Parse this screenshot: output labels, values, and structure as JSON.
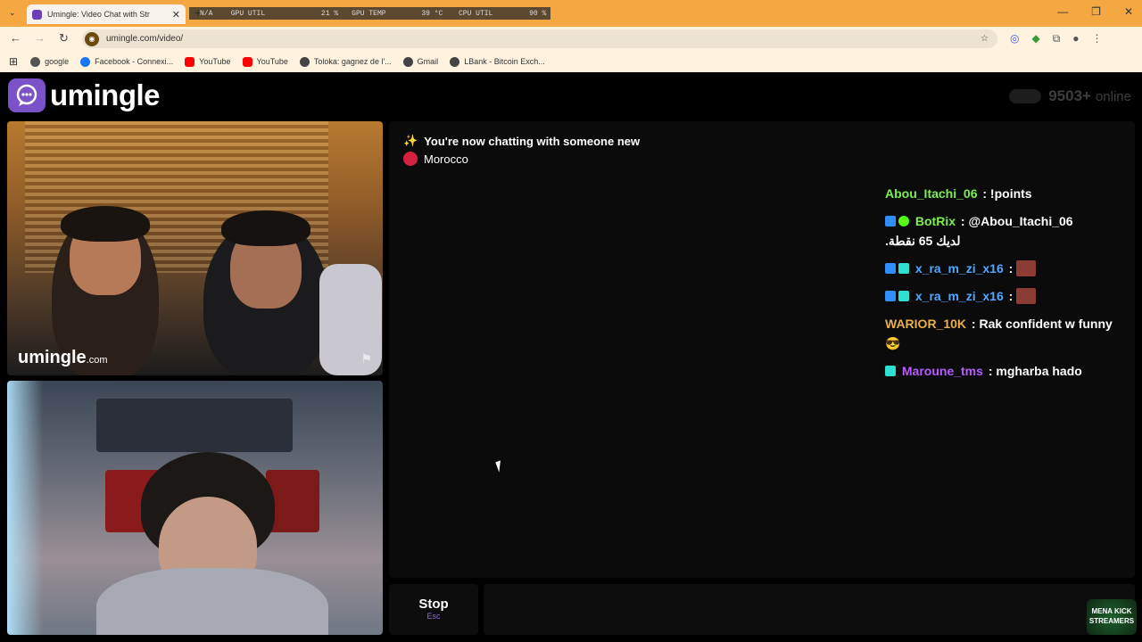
{
  "browser": {
    "tab_title": "Umingle: Video Chat with Str",
    "overlay": {
      "gpu_util_label": "GPU UTIL",
      "gpu_util_value": "21 %",
      "gpu_temp_label": "GPU TEMP",
      "gpu_temp_value": "39 °C",
      "cpu_util_label": "CPU UTIL",
      "cpu_util_value": "90 %",
      "na_label": "N/A"
    },
    "url": "umingle.com/video/",
    "bookmarks": [
      {
        "label": "google",
        "color": "#555555"
      },
      {
        "label": "Facebook - Connexi...",
        "color": "#1877f2"
      },
      {
        "label": "YouTube",
        "color": "#ff0000"
      },
      {
        "label": "YouTube",
        "color": "#ff0000"
      },
      {
        "label": "Toloka: gagnez de l'...",
        "color": "#444444"
      },
      {
        "label": "Gmail",
        "color": "#444444"
      },
      {
        "label": "LBank - Bitcoin Exch...",
        "color": "#444444"
      }
    ]
  },
  "site": {
    "logo_text": "umingle",
    "online_count": "9503+",
    "online_label": "online",
    "watermark_main": "umingle",
    "watermark_suffix": ".com"
  },
  "chat": {
    "system_message": "You're now chatting with someone new",
    "country": "Morocco",
    "messages": [
      {
        "name": "Abou_Itachi_06",
        "name_color": "#7cf04f",
        "text": ": !points"
      },
      {
        "name": "BotRix",
        "name_color": "#7cf04f",
        "text": ": @Abou_Itachi_06",
        "text_color": "#6fa8ff",
        "line2": "لديك 65 نقطة."
      },
      {
        "name": "x_ra_m_zi_x16",
        "name_color": "#52a8ff",
        "text": ":"
      },
      {
        "name": "x_ra_m_zi_x16",
        "name_color": "#52a8ff",
        "text": ":"
      },
      {
        "name": "WARIOR_10K",
        "name_color": "#e8b04a",
        "text": ": Rak confident w funny"
      },
      {
        "name": "Maroune_tms",
        "name_color": "#b65cff",
        "text": ": mgharba hado"
      }
    ]
  },
  "controls": {
    "stop_label": "Stop",
    "stop_key": "Esc"
  },
  "corner_logo": {
    "line1": "MENA KICK",
    "line2": "STREAMERS"
  }
}
